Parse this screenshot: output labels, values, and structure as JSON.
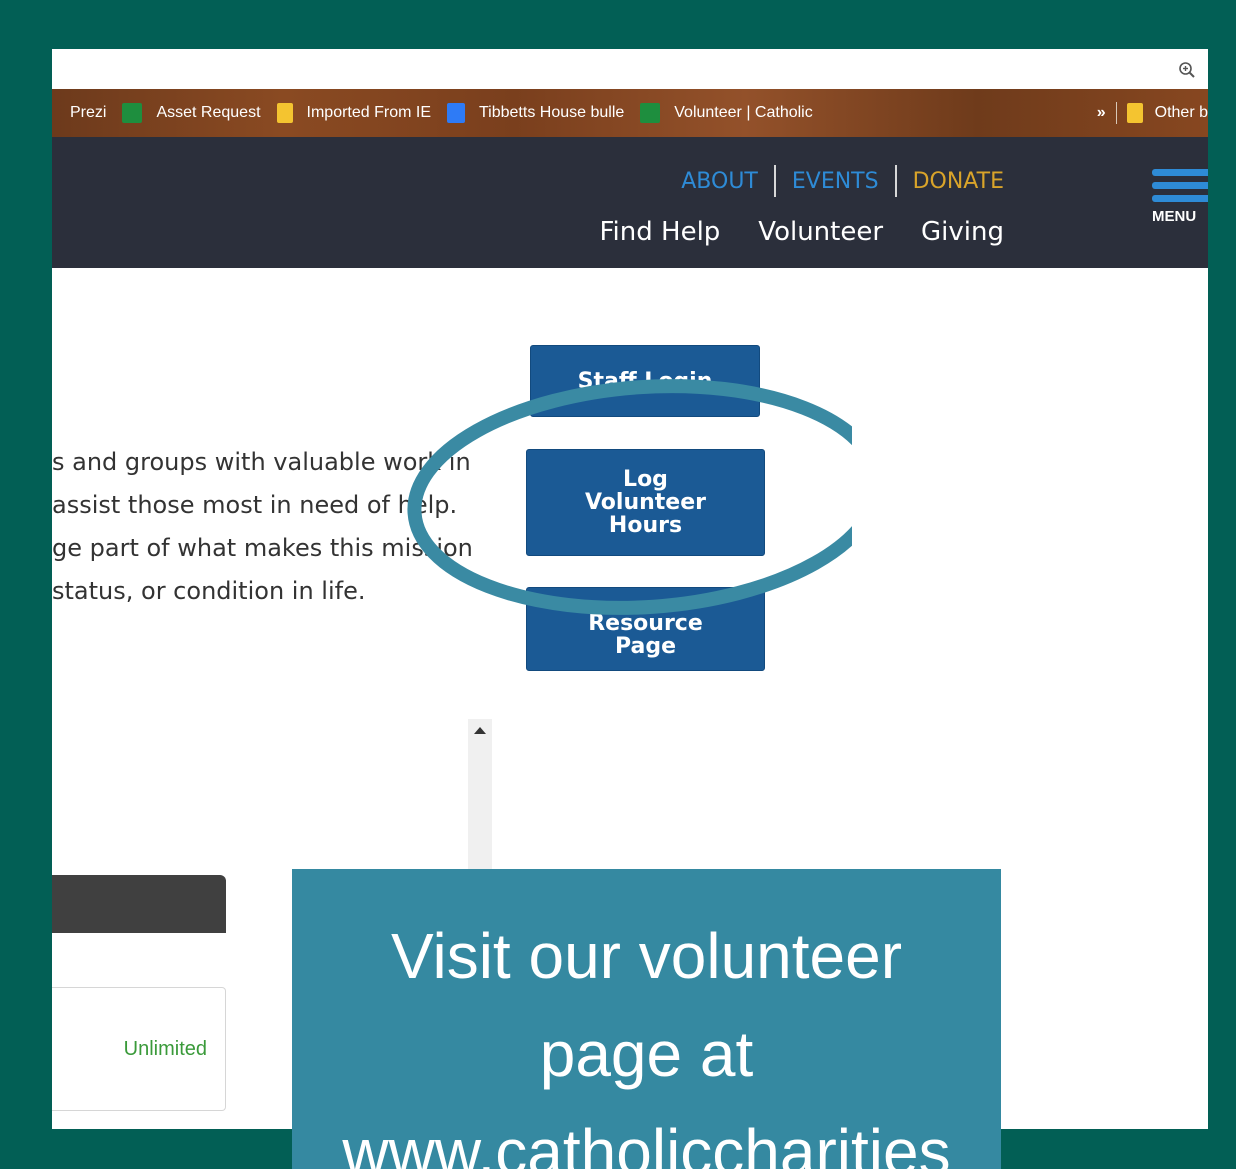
{
  "bookmarks": {
    "items": [
      {
        "label": "Prezi",
        "icon": "prezi-icon",
        "color": ""
      },
      {
        "label": "Asset Request",
        "icon": "sheets-icon",
        "color": "#1e8e3e"
      },
      {
        "label": "Imported From IE",
        "icon": "folder-icon",
        "color": "#f4c430"
      },
      {
        "label": "Tibbetts House bulle",
        "icon": "docs-icon",
        "color": "#2e7bf6"
      },
      {
        "label": "Volunteer | Catholic",
        "icon": "sheets-icon",
        "color": "#1e8e3e"
      }
    ],
    "overflow": "»",
    "other": "Other b"
  },
  "header": {
    "top_links": {
      "about": "ABOUT",
      "events": "EVENTS",
      "donate": "DONATE"
    },
    "nav": {
      "find_help": "Find Help",
      "volunteer": "Volunteer",
      "giving": "Giving"
    },
    "menu_label": "MENU",
    "colors": {
      "background": "#2b2f3b",
      "link": "#2e8bd6",
      "donate": "#d9a42a"
    }
  },
  "intro": {
    "lines": [
      "s and groups with valuable work in",
      "assist those most in need of help.",
      "ge part of what makes this mission",
      " status, or condition in life."
    ]
  },
  "buttons": {
    "staff_login": "Staff Login",
    "log_hours": {
      "line1": "Log",
      "line2": "Volunteer",
      "line3": "Hours"
    },
    "resource": {
      "line1": "Resource",
      "line2": "Page"
    },
    "color": "#1b5a95"
  },
  "widget": {
    "status": "Unlimited"
  },
  "callout": {
    "line1": "Visit our volunteer",
    "line2": "page at",
    "line3": "www.catholiccharities",
    "color": "#3589a1"
  },
  "frame_color": "#025f55"
}
